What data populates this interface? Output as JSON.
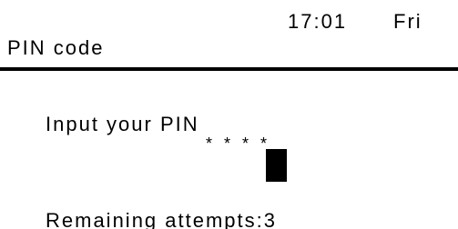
{
  "status_bar": {
    "time": "17:01",
    "day": "Fri"
  },
  "header": {
    "title": "PIN code"
  },
  "pin_entry": {
    "prompt": "Input your PIN",
    "masked_value": "* * * *",
    "remaining_attempts_text": "Remaining attempts:3"
  }
}
